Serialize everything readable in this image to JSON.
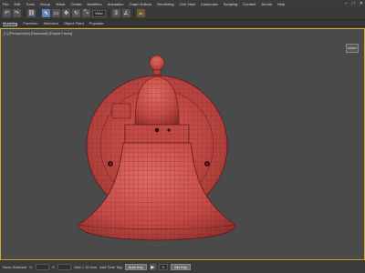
{
  "menu": {
    "items": [
      "File",
      "Edit",
      "Tools",
      "Group",
      "Views",
      "Create",
      "Modifiers",
      "Animation",
      "Graph Editors",
      "Rendering",
      "Civil View",
      "Customize",
      "Scripting",
      "Content",
      "Arnold",
      "Help"
    ],
    "minimize": "–",
    "maximize": "□",
    "close": "✕"
  },
  "toolbar": {
    "undo": "↶",
    "redo": "↷",
    "link": "⛓",
    "select": "⬉",
    "select_region": "▭",
    "move": "✥",
    "rotate": "↻",
    "scale": "⤡",
    "reference_coord": "View",
    "snap": "3",
    "angle_snap": "∠",
    "render": "☕"
  },
  "ribbon": {
    "tabs": [
      "Modeling",
      "Freeform",
      "Selection",
      "Object Paint",
      "Populate"
    ]
  },
  "viewport": {
    "label": "[+] [Perspective] [Standard] [Edged Faces]",
    "viewcube_label": "FRONT"
  },
  "status": {
    "selection_text": "None Selected",
    "x_label": "X:",
    "y_label": "Y:",
    "grid_text": "Grid = 10.0cm",
    "frame": "0",
    "autokey_label": "Auto Key",
    "setkey_label": "Set Key",
    "play": "▶",
    "add_time_tag": "Add Time Tag"
  }
}
